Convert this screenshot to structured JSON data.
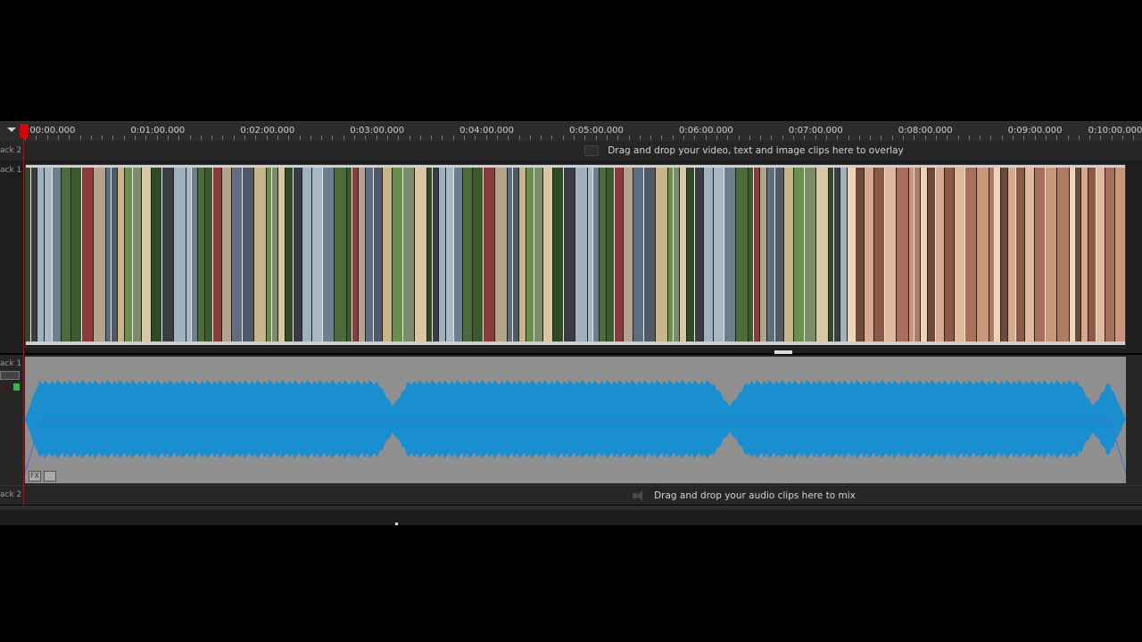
{
  "ruler": {
    "ticks": [
      {
        "label": "0:00:00.000",
        "t": 0
      },
      {
        "label": "0:01:00.000",
        "t": 1
      },
      {
        "label": "0:02:00.000",
        "t": 2
      },
      {
        "label": "0:03:00.000",
        "t": 3
      },
      {
        "label": "0:04:00.000",
        "t": 4
      },
      {
        "label": "0:05:00.000",
        "t": 5
      },
      {
        "label": "0:06:00.000",
        "t": 6
      },
      {
        "label": "0:07:00.000",
        "t": 7
      },
      {
        "label": "0:08:00.000",
        "t": 8
      },
      {
        "label": "0:09:00.000",
        "t": 9
      },
      {
        "label": "0:10:00.000",
        "t": 10
      }
    ]
  },
  "tracks": {
    "video_2": {
      "label": "ack 2",
      "drop_text": "Drag and drop your video, text and image clips here to overlay"
    },
    "video_1": {
      "label": "ack 1"
    },
    "audio_1": {
      "label": "ack 1",
      "fx_label": "FX"
    },
    "audio_2": {
      "label": "ack 2",
      "drop_text": "Drag and drop your audio clips here to mix"
    }
  },
  "colors": {
    "playhead": "#d80000",
    "waveform": "#1a8fd0",
    "audio_clip_bg": "#8f8f8f"
  }
}
